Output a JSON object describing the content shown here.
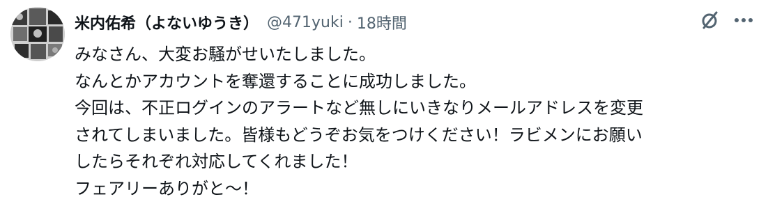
{
  "author": {
    "display_name": "米内佑希（よないゆうき）",
    "handle": "@471yuki",
    "separator": "·",
    "timestamp": "18時間"
  },
  "icons": {
    "avatar": "avatar-photo-collage",
    "grok": "slashed-circle-icon",
    "more": "more-horizontal-icon"
  },
  "body_lines": [
    "みなさん、大変お騒がせいたしました。",
    "なんとかアカウントを奪還することに成功しました。",
    "今回は、不正ログインのアラートなど無しにいきなりメールアドレスを変更",
    "されてしまいました。皆様もどうぞお気をつけください！ラビメンにお願い",
    "したらそれぞれ対応してくれました！",
    "フェアリーありがと〜！"
  ],
  "colors": {
    "text": "#0f1419",
    "secondary": "#536471"
  }
}
